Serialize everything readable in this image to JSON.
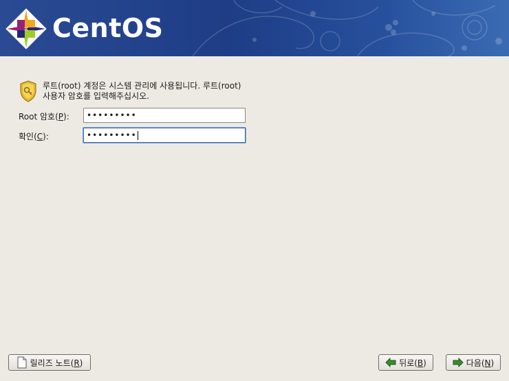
{
  "header": {
    "brand": "CentOS",
    "logo_icon": "centos-logo-icon"
  },
  "info": {
    "icon": "shield-key-icon",
    "line1": "루트(root) 계정은 시스템 관리에 사용됩니다. 루트(root)",
    "line2": "사용자 암호를 입력해주십시오."
  },
  "fields": {
    "root_password": {
      "label_pre": "Root 암호(",
      "mnemonic": "P",
      "label_post": "):",
      "masked_value": "•••••••••"
    },
    "confirm": {
      "label_pre": "확인(",
      "mnemonic": "C",
      "label_post": "):",
      "masked_value": "•••••••••"
    }
  },
  "buttons": {
    "release_notes": {
      "pre": "릴리즈 노트(",
      "mnemonic": "R",
      "post": ")",
      "icon": "document-icon"
    },
    "back": {
      "pre": "뒤로(",
      "mnemonic": "B",
      "post": ")",
      "icon": "arrow-left-icon"
    },
    "next": {
      "pre": "다음(",
      "mnemonic": "N",
      "post": ")",
      "icon": "arrow-right-icon"
    }
  },
  "colors": {
    "banner": "#1e3d86",
    "background": "#edeae4",
    "arrow_green": "#3d8a2f"
  }
}
